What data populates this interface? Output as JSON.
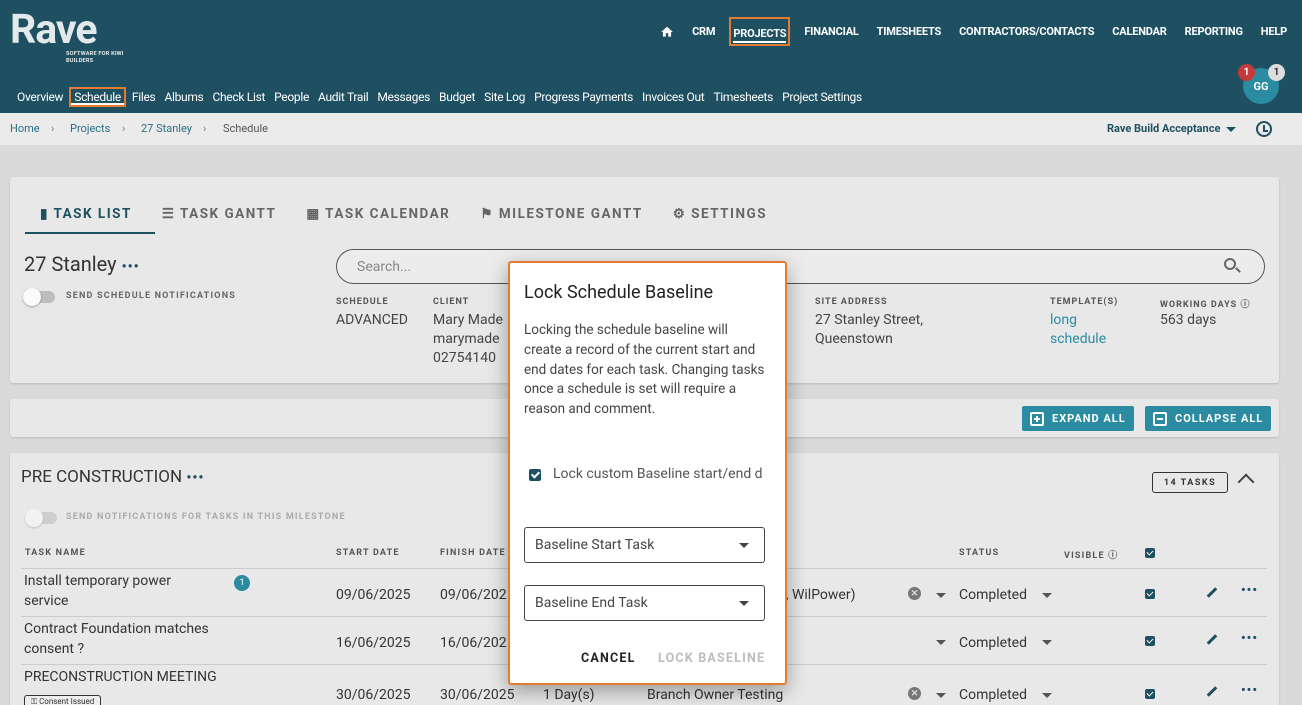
{
  "header": {
    "logo": "Rave",
    "logo_sub": "SOFTWARE FOR KIWI BUILDERS",
    "top_nav": [
      "CRM",
      "PROJECTS",
      "FINANCIAL",
      "TIMESHEETS",
      "CONTRACTORS/CONTACTS",
      "CALENDAR",
      "REPORTING",
      "HELP"
    ],
    "sub_nav": [
      "Overview",
      "Schedule",
      "Files",
      "Albums",
      "Check List",
      "People",
      "Audit Trail",
      "Messages",
      "Budget",
      "Site Log",
      "Progress Payments",
      "Invoices Out",
      "Timesheets",
      "Project Settings"
    ],
    "avatar": "GG",
    "badge_red": "1",
    "badge_grey": "1",
    "colors": {
      "header_bg": "#1e5062",
      "highlight": "#e57a33",
      "accent": "#2b8ba1"
    }
  },
  "breadcrumb": {
    "items": [
      "Home",
      "Projects",
      "27 Stanley",
      "Schedule"
    ],
    "separator": "›",
    "org": "Rave Build Acceptance"
  },
  "tabs": [
    "TASK LIST",
    "TASK GANTT",
    "TASK CALENDAR",
    "MILESTONE GANTT",
    "SETTINGS"
  ],
  "project": {
    "name": "27 Stanley",
    "more": "•••",
    "toggle_label": "SEND SCHEDULE NOTIFICATIONS",
    "search_placeholder": "Search...",
    "info": {
      "schedule_label": "SCHEDULE",
      "schedule_value": "ADVANCED",
      "client_label": "CLIENT",
      "client_line1": "Mary Made",
      "client_line2": "marymade",
      "client_line3": "02754140",
      "site_label": "SITE ADDRESS",
      "site_line1": "27 Stanley Street,",
      "site_line2": "Queenstown",
      "template_label": "TEMPLATE(S)",
      "template_line1": "long",
      "template_line2": "schedule",
      "working_label": "WORKING DAYS",
      "working_value": "563 days"
    }
  },
  "actions": {
    "expand": "EXPAND ALL",
    "collapse": "COLLAPSE ALL"
  },
  "milestone": {
    "name": "PRE CONSTRUCTION",
    "more": "•••",
    "toggle_label": "SEND NOTIFICATIONS FOR TASKS IN THIS MILESTONE",
    "task_count": "14 TASKS",
    "columns": {
      "name": "TASK NAME",
      "start": "START DATE",
      "finish": "FINISH DATE",
      "status": "STATUS",
      "visible": "VISIBLE"
    },
    "rows": [
      {
        "name_1": "Install temporary power",
        "name_2": "service",
        "start": "09/06/2025",
        "finish": "09/06/202",
        "assignee": "n, WilPower)",
        "status": "Completed",
        "comment_count": "1"
      },
      {
        "name_1": "Contract Foundation matches",
        "name_2": "consent ?",
        "start": "16/06/2025",
        "finish": "16/06/202",
        "assignee": "",
        "status": "Completed"
      },
      {
        "name_1": "PRECONSTRUCTION MEETING",
        "name_2": "",
        "start": "30/06/2025",
        "finish": "30/06/2025",
        "duration": "1 Day(s)",
        "assignee": "Branch Owner Testing",
        "status": "Completed",
        "tag": "Consent Issued"
      }
    ]
  },
  "modal": {
    "title": "Lock Schedule Baseline",
    "body": "Locking the schedule baseline will create a record of the current start and end dates for each task. Changing tasks once a schedule is set will require a reason and comment.",
    "checkbox_label": "Lock custom Baseline start/end d",
    "start_select": "Baseline Start Task",
    "end_select": "Baseline End Task",
    "cancel": "CANCEL",
    "confirm": "LOCK BASELINE"
  }
}
